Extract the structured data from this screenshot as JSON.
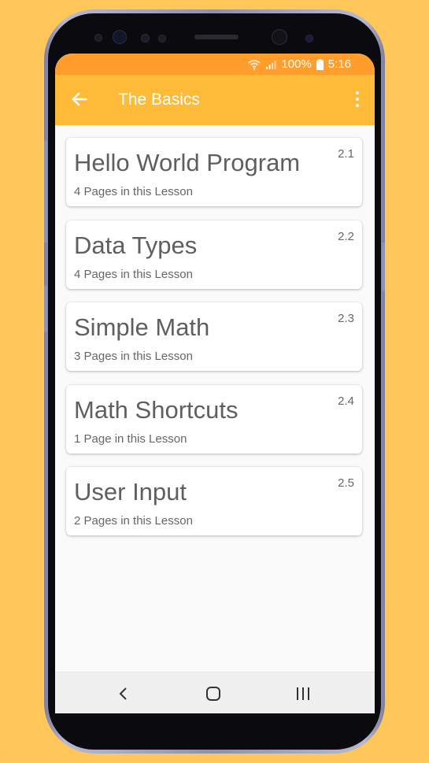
{
  "status_bar": {
    "battery_percent": "100%",
    "time": "5:16",
    "icons": [
      "wifi-icon",
      "signal-icon",
      "battery-icon"
    ]
  },
  "app_bar": {
    "title": "The Basics",
    "back_icon": "arrow-left-icon",
    "menu_icon": "more-vert-icon"
  },
  "lessons": [
    {
      "title": "Hello World Program",
      "pages": "4 Pages in this Lesson",
      "number": "2.1"
    },
    {
      "title": "Data Types",
      "pages": "4 Pages in this Lesson",
      "number": "2.2"
    },
    {
      "title": "Simple Math",
      "pages": "3 Pages in this Lesson",
      "number": "2.3"
    },
    {
      "title": "Math Shortcuts",
      "pages": "1 Page in this Lesson",
      "number": "2.4"
    },
    {
      "title": "User Input",
      "pages": "2 Pages in this Lesson",
      "number": "2.5"
    }
  ],
  "nav_bar": {
    "icons": [
      "back-chevron-icon",
      "home-icon",
      "recent-apps-icon"
    ]
  },
  "colors": {
    "background": "#ffc65a",
    "status_bar": "#ff9d2d",
    "app_bar": "#ffba37",
    "screen": "#fafafa",
    "card": "#ffffff",
    "text_primary": "#5f5f5f"
  }
}
